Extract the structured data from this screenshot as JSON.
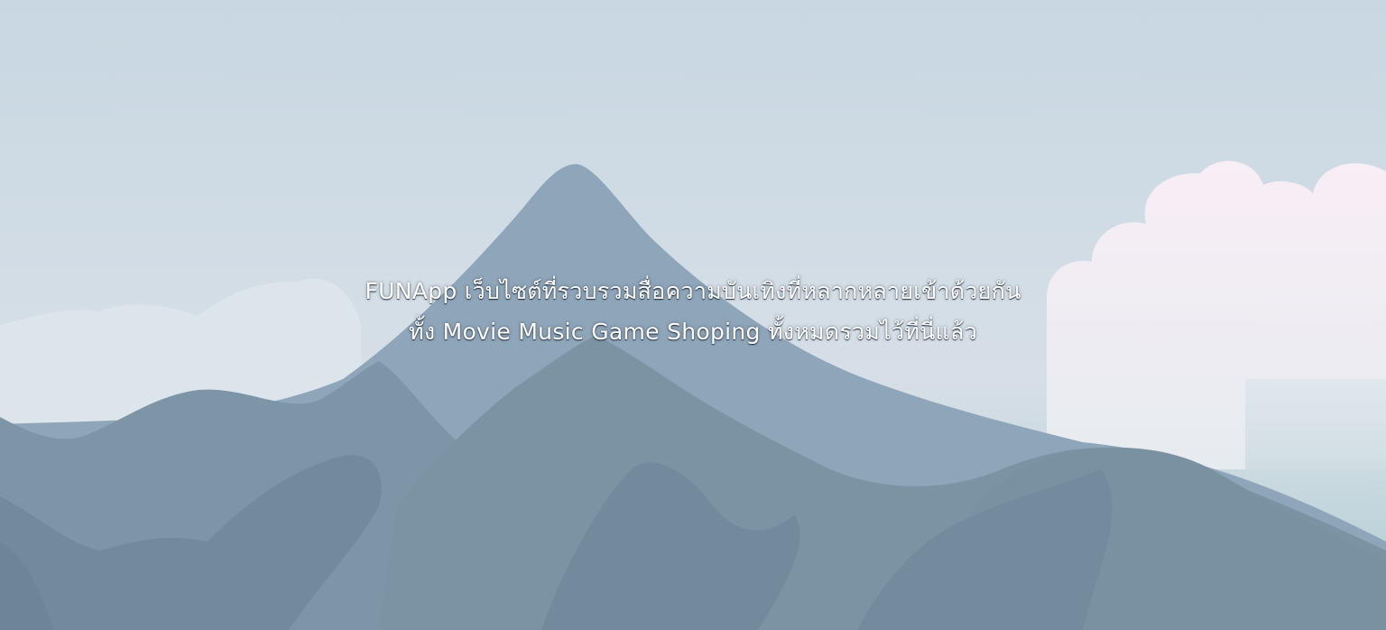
{
  "hero": {
    "line1": "FUNApp เว็บไซต์ที่รวบรวมสื่อความบันเทิงที่หลากหลายเข้าด้วยกัน",
    "line2": "ทั้ง Movie Music Game Shoping ทั้งหมดรวมไว้ที่นี่แล้ว"
  },
  "colors": {
    "sky_top": "#c9d7e2",
    "sky_bottom": "#e2e9ef",
    "cloud": "#f6eef4",
    "mountain_far": "#8fa5b9",
    "mountain_mid": "#7d95a6",
    "mountain_near": "#71889a"
  }
}
